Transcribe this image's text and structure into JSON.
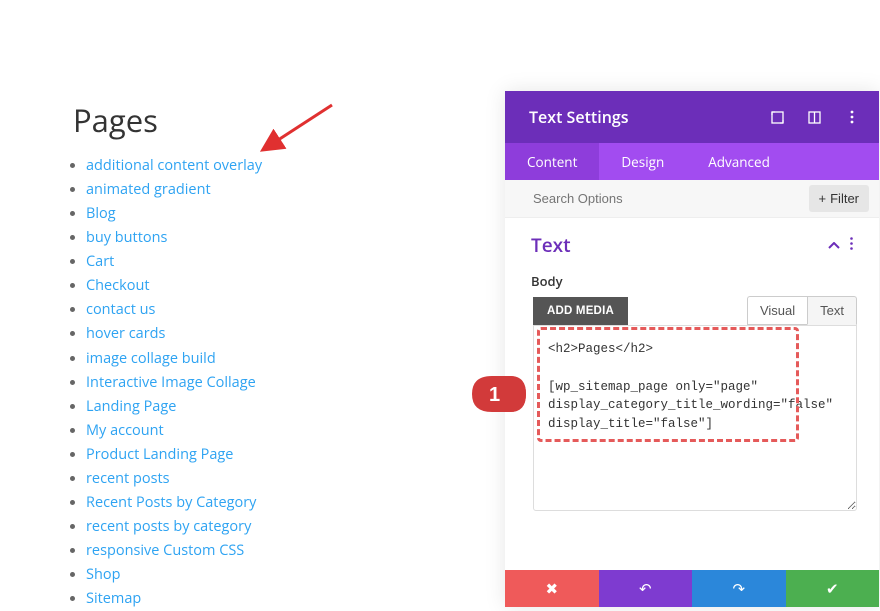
{
  "heading": "Pages",
  "pages": [
    "additional content overlay",
    "animated gradient",
    "Blog",
    "buy buttons",
    "Cart",
    "Checkout",
    "contact us",
    "hover cards",
    "image collage build",
    "Interactive Image Collage",
    "Landing Page",
    "My account",
    "Product Landing Page",
    "recent posts",
    "Recent Posts by Category",
    "recent posts by category",
    "responsive Custom CSS",
    "Shop",
    "Sitemap"
  ],
  "panel": {
    "title": "Text Settings",
    "tabs": [
      "Content",
      "Design",
      "Advanced"
    ],
    "active_tab": 0,
    "search_placeholder": "Search Options",
    "filter_label": "Filter",
    "section_title": "Text",
    "body_label": "Body",
    "add_media_label": "ADD MEDIA",
    "editor_tabs": [
      "Visual",
      "Text"
    ],
    "editor_active": 1,
    "editor_content": "<h2>Pages</h2>\n\n[wp_sitemap_page only=\"page\" display_category_title_wording=\"false\" display_title=\"false\"]"
  },
  "marker_label": "1"
}
